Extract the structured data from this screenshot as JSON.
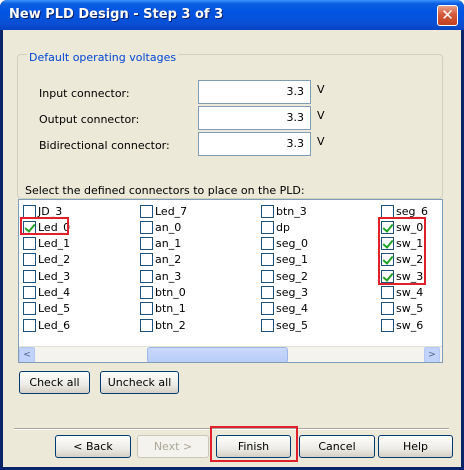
{
  "window": {
    "title": "New PLD Design - Step 3 of 3",
    "close_glyph": "✕"
  },
  "voltages": {
    "group_label": "Default operating voltages",
    "rows": [
      {
        "label": "Input connector:",
        "value": "3.3",
        "unit": "V"
      },
      {
        "label": "Output connector:",
        "value": "3.3",
        "unit": "V"
      },
      {
        "label": "Bidirectional connector:",
        "value": "3.3",
        "unit": "V"
      }
    ]
  },
  "connectors": {
    "label": "Select the defined connectors to place on the PLD:",
    "columns": [
      [
        {
          "label": "JD_3",
          "checked": false
        },
        {
          "label": "Led_0",
          "checked": true
        },
        {
          "label": "Led_1",
          "checked": false
        },
        {
          "label": "Led_2",
          "checked": false
        },
        {
          "label": "Led_3",
          "checked": false
        },
        {
          "label": "Led_4",
          "checked": false
        },
        {
          "label": "Led_5",
          "checked": false
        },
        {
          "label": "Led_6",
          "checked": false
        }
      ],
      [
        {
          "label": "Led_7",
          "checked": false
        },
        {
          "label": "an_0",
          "checked": false
        },
        {
          "label": "an_1",
          "checked": false
        },
        {
          "label": "an_2",
          "checked": false
        },
        {
          "label": "an_3",
          "checked": false
        },
        {
          "label": "btn_0",
          "checked": false
        },
        {
          "label": "btn_1",
          "checked": false
        },
        {
          "label": "btn_2",
          "checked": false
        }
      ],
      [
        {
          "label": "btn_3",
          "checked": false
        },
        {
          "label": "dp",
          "checked": false
        },
        {
          "label": "seg_0",
          "checked": false
        },
        {
          "label": "seg_1",
          "checked": false
        },
        {
          "label": "seg_2",
          "checked": false
        },
        {
          "label": "seg_3",
          "checked": false
        },
        {
          "label": "seg_4",
          "checked": false
        },
        {
          "label": "seg_5",
          "checked": false
        }
      ],
      [
        {
          "label": "seg_6",
          "checked": false
        },
        {
          "label": "sw_0",
          "checked": true
        },
        {
          "label": "sw_1",
          "checked": true
        },
        {
          "label": "sw_2",
          "checked": true
        },
        {
          "label": "sw_3",
          "checked": true
        },
        {
          "label": "sw_4",
          "checked": false
        },
        {
          "label": "sw_5",
          "checked": false
        },
        {
          "label": "sw_6",
          "checked": false
        }
      ]
    ],
    "scroll_left_glyph": "<",
    "scroll_right_glyph": ">"
  },
  "buttons": {
    "check_all": "Check all",
    "uncheck_all": "Uncheck all",
    "back": "< Back",
    "next": "Next >",
    "finish": "Finish",
    "cancel": "Cancel",
    "help": "Help"
  },
  "colors": {
    "highlight": "#e0202a",
    "title_bar": "#0054e3",
    "dialog_bg": "#ece9d8"
  }
}
